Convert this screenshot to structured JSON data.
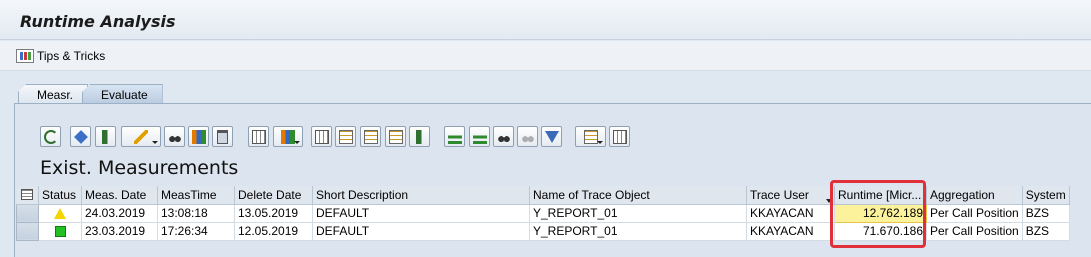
{
  "app": {
    "title": "Runtime Analysis"
  },
  "appbar": {
    "tips_label": "Tips & Tricks"
  },
  "tabs": [
    {
      "label": "Measr.",
      "active": false
    },
    {
      "label": "Evaluate",
      "active": true
    }
  ],
  "toolbar": {
    "buttons": [
      {
        "icon": "refresh-icon"
      },
      {
        "icon": "details-icon"
      },
      {
        "icon": "compare-icon"
      },
      {
        "icon": "edit-icon"
      },
      {
        "icon": "display-icon"
      },
      {
        "icon": "chart-icon"
      },
      {
        "icon": "delete-icon"
      },
      {
        "icon": "settings-icon"
      },
      {
        "icon": "sort-icon"
      },
      {
        "icon": "expand-icon"
      },
      {
        "icon": "collapse-icon"
      },
      {
        "icon": "export-icon"
      },
      {
        "icon": "transfer-icon"
      },
      {
        "icon": "sort-ascending-icon"
      },
      {
        "icon": "sort-descending-icon"
      },
      {
        "icon": "find-icon"
      },
      {
        "icon": "find-next-icon"
      },
      {
        "icon": "filter-icon"
      },
      {
        "icon": "layout-icon"
      },
      {
        "icon": "select-layout-icon"
      }
    ]
  },
  "section": {
    "title": "Exist. Measurements"
  },
  "table": {
    "columns": [
      "Status",
      "Meas. Date",
      "MeasTime",
      "Delete Date",
      "Short Description",
      "Name of Trace Object",
      "Trace User",
      "Runtime [Micr...",
      "Aggregation",
      "System"
    ],
    "rows": [
      {
        "status": "warning",
        "status_color": "#f5d400",
        "meas_date": "24.03.2019",
        "meas_time": "13:08:18",
        "delete_date": "13.05.2019",
        "short_description": "DEFAULT",
        "trace_object": "Y_REPORT_01",
        "trace_user": "KKAYACAN",
        "runtime": "12.762.189",
        "aggregation": "Per Call Position",
        "system": "BZS"
      },
      {
        "status": "ok",
        "status_color": "#22c022",
        "meas_date": "23.03.2019",
        "meas_time": "17:26:34",
        "delete_date": "12.05.2019",
        "short_description": "DEFAULT",
        "trace_object": "Y_REPORT_01",
        "trace_user": "KKAYACAN",
        "runtime": "71.670.186",
        "aggregation": "Per Call Position",
        "system": "BZS"
      }
    ]
  },
  "colors": {
    "highlight_box": "#e0303a",
    "selected_cell": "#fdf29c"
  }
}
